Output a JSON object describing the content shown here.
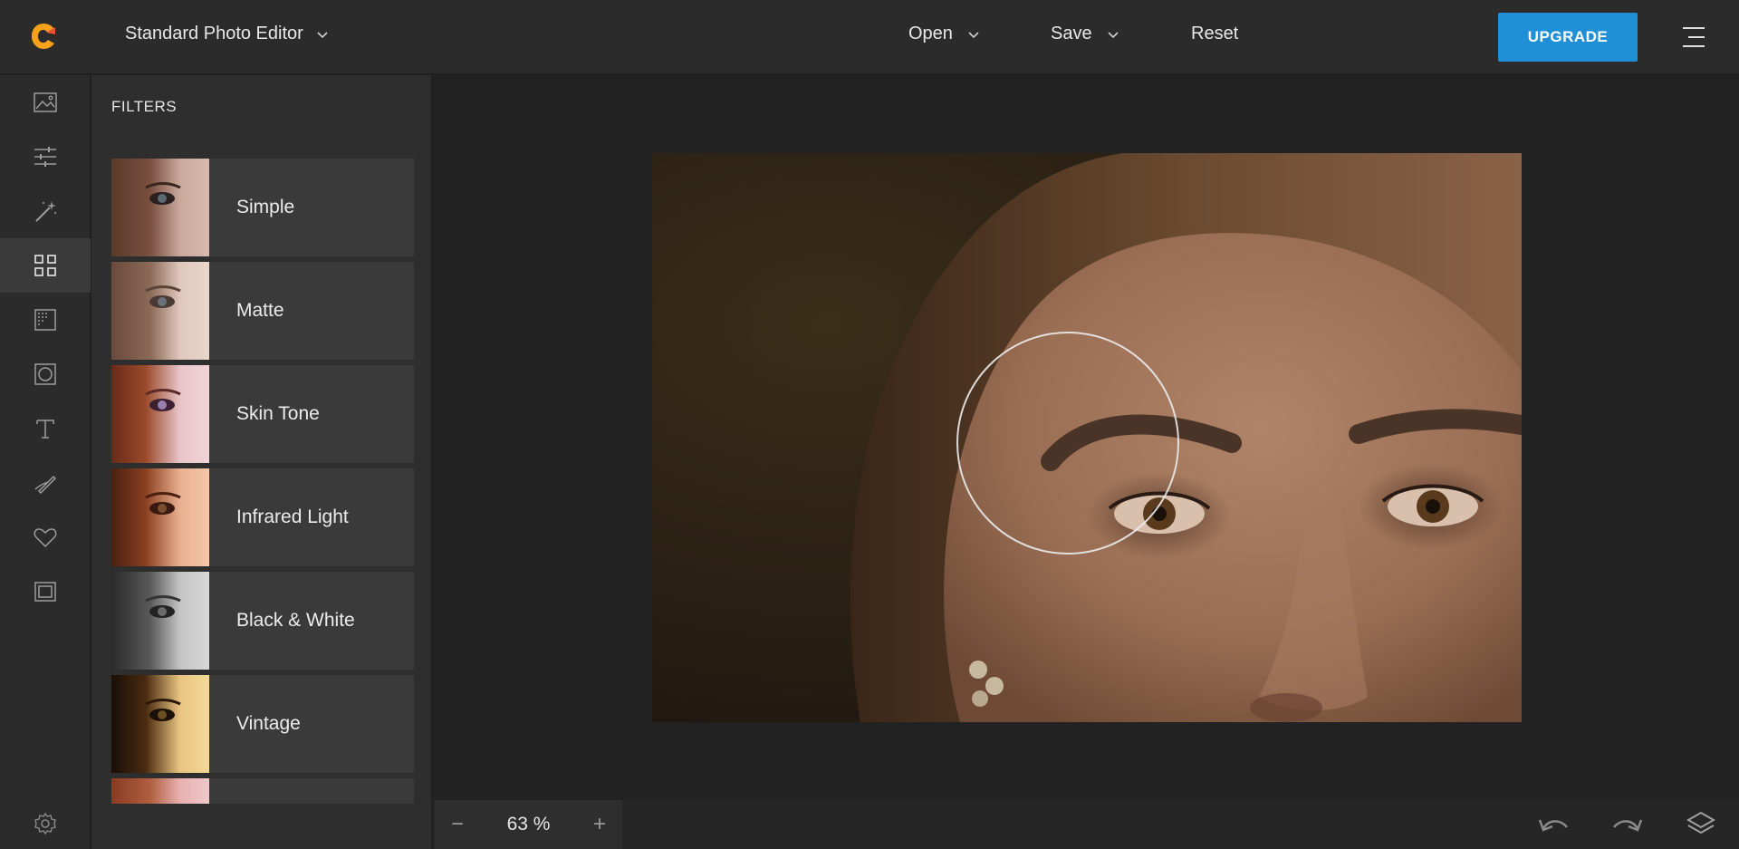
{
  "app": {
    "editor_name": "Standard Photo Editor",
    "accent_color": "#1f8fd8"
  },
  "header": {
    "open_label": "Open",
    "save_label": "Save",
    "reset_label": "Reset",
    "upgrade_label": "UPGRADE"
  },
  "rail": {
    "items": [
      {
        "icon": "image-icon"
      },
      {
        "icon": "adjust-sliders-icon"
      },
      {
        "icon": "magic-wand-icon"
      },
      {
        "icon": "filters-grid-icon",
        "active": true
      },
      {
        "icon": "texture-icon"
      },
      {
        "icon": "vignette-icon"
      },
      {
        "icon": "text-icon"
      },
      {
        "icon": "brush-icon"
      },
      {
        "icon": "heart-icon"
      },
      {
        "icon": "frame-icon"
      }
    ],
    "settings_icon": "gear-icon"
  },
  "panel": {
    "title": "FILTERS",
    "filters": [
      {
        "label": "Simple"
      },
      {
        "label": "Matte"
      },
      {
        "label": "Skin Tone"
      },
      {
        "label": "Infrared Light"
      },
      {
        "label": "Black & White"
      },
      {
        "label": "Vintage"
      }
    ]
  },
  "bottombar": {
    "zoom_value": "63 %",
    "zoom_minus": "−",
    "zoom_plus": "+"
  }
}
